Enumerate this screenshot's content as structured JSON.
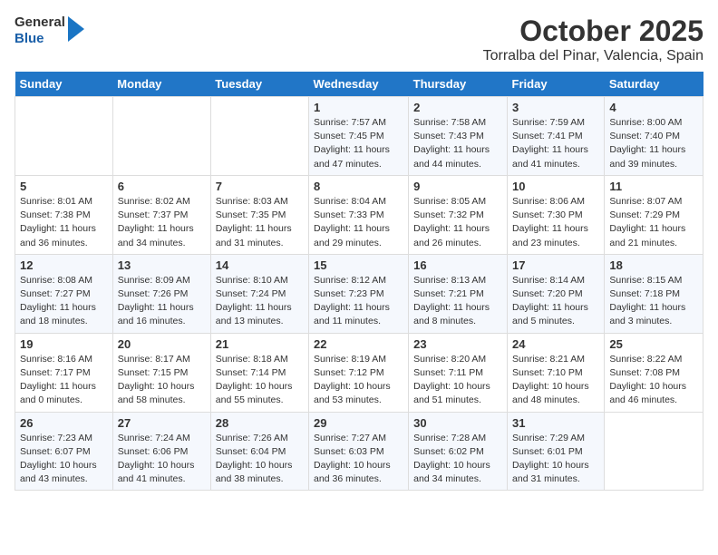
{
  "header": {
    "logo_general": "General",
    "logo_blue": "Blue",
    "title": "October 2025",
    "subtitle": "Torralba del Pinar, Valencia, Spain"
  },
  "weekdays": [
    "Sunday",
    "Monday",
    "Tuesday",
    "Wednesday",
    "Thursday",
    "Friday",
    "Saturday"
  ],
  "weeks": [
    [
      {
        "day": "",
        "info": ""
      },
      {
        "day": "",
        "info": ""
      },
      {
        "day": "",
        "info": ""
      },
      {
        "day": "1",
        "info": "Sunrise: 7:57 AM\nSunset: 7:45 PM\nDaylight: 11 hours and 47 minutes."
      },
      {
        "day": "2",
        "info": "Sunrise: 7:58 AM\nSunset: 7:43 PM\nDaylight: 11 hours and 44 minutes."
      },
      {
        "day": "3",
        "info": "Sunrise: 7:59 AM\nSunset: 7:41 PM\nDaylight: 11 hours and 41 minutes."
      },
      {
        "day": "4",
        "info": "Sunrise: 8:00 AM\nSunset: 7:40 PM\nDaylight: 11 hours and 39 minutes."
      }
    ],
    [
      {
        "day": "5",
        "info": "Sunrise: 8:01 AM\nSunset: 7:38 PM\nDaylight: 11 hours and 36 minutes."
      },
      {
        "day": "6",
        "info": "Sunrise: 8:02 AM\nSunset: 7:37 PM\nDaylight: 11 hours and 34 minutes."
      },
      {
        "day": "7",
        "info": "Sunrise: 8:03 AM\nSunset: 7:35 PM\nDaylight: 11 hours and 31 minutes."
      },
      {
        "day": "8",
        "info": "Sunrise: 8:04 AM\nSunset: 7:33 PM\nDaylight: 11 hours and 29 minutes."
      },
      {
        "day": "9",
        "info": "Sunrise: 8:05 AM\nSunset: 7:32 PM\nDaylight: 11 hours and 26 minutes."
      },
      {
        "day": "10",
        "info": "Sunrise: 8:06 AM\nSunset: 7:30 PM\nDaylight: 11 hours and 23 minutes."
      },
      {
        "day": "11",
        "info": "Sunrise: 8:07 AM\nSunset: 7:29 PM\nDaylight: 11 hours and 21 minutes."
      }
    ],
    [
      {
        "day": "12",
        "info": "Sunrise: 8:08 AM\nSunset: 7:27 PM\nDaylight: 11 hours and 18 minutes."
      },
      {
        "day": "13",
        "info": "Sunrise: 8:09 AM\nSunset: 7:26 PM\nDaylight: 11 hours and 16 minutes."
      },
      {
        "day": "14",
        "info": "Sunrise: 8:10 AM\nSunset: 7:24 PM\nDaylight: 11 hours and 13 minutes."
      },
      {
        "day": "15",
        "info": "Sunrise: 8:12 AM\nSunset: 7:23 PM\nDaylight: 11 hours and 11 minutes."
      },
      {
        "day": "16",
        "info": "Sunrise: 8:13 AM\nSunset: 7:21 PM\nDaylight: 11 hours and 8 minutes."
      },
      {
        "day": "17",
        "info": "Sunrise: 8:14 AM\nSunset: 7:20 PM\nDaylight: 11 hours and 5 minutes."
      },
      {
        "day": "18",
        "info": "Sunrise: 8:15 AM\nSunset: 7:18 PM\nDaylight: 11 hours and 3 minutes."
      }
    ],
    [
      {
        "day": "19",
        "info": "Sunrise: 8:16 AM\nSunset: 7:17 PM\nDaylight: 11 hours and 0 minutes."
      },
      {
        "day": "20",
        "info": "Sunrise: 8:17 AM\nSunset: 7:15 PM\nDaylight: 10 hours and 58 minutes."
      },
      {
        "day": "21",
        "info": "Sunrise: 8:18 AM\nSunset: 7:14 PM\nDaylight: 10 hours and 55 minutes."
      },
      {
        "day": "22",
        "info": "Sunrise: 8:19 AM\nSunset: 7:12 PM\nDaylight: 10 hours and 53 minutes."
      },
      {
        "day": "23",
        "info": "Sunrise: 8:20 AM\nSunset: 7:11 PM\nDaylight: 10 hours and 51 minutes."
      },
      {
        "day": "24",
        "info": "Sunrise: 8:21 AM\nSunset: 7:10 PM\nDaylight: 10 hours and 48 minutes."
      },
      {
        "day": "25",
        "info": "Sunrise: 8:22 AM\nSunset: 7:08 PM\nDaylight: 10 hours and 46 minutes."
      }
    ],
    [
      {
        "day": "26",
        "info": "Sunrise: 7:23 AM\nSunset: 6:07 PM\nDaylight: 10 hours and 43 minutes."
      },
      {
        "day": "27",
        "info": "Sunrise: 7:24 AM\nSunset: 6:06 PM\nDaylight: 10 hours and 41 minutes."
      },
      {
        "day": "28",
        "info": "Sunrise: 7:26 AM\nSunset: 6:04 PM\nDaylight: 10 hours and 38 minutes."
      },
      {
        "day": "29",
        "info": "Sunrise: 7:27 AM\nSunset: 6:03 PM\nDaylight: 10 hours and 36 minutes."
      },
      {
        "day": "30",
        "info": "Sunrise: 7:28 AM\nSunset: 6:02 PM\nDaylight: 10 hours and 34 minutes."
      },
      {
        "day": "31",
        "info": "Sunrise: 7:29 AM\nSunset: 6:01 PM\nDaylight: 10 hours and 31 minutes."
      },
      {
        "day": "",
        "info": ""
      }
    ]
  ]
}
